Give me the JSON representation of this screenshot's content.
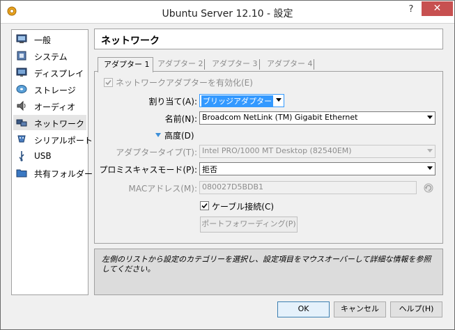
{
  "window": {
    "title": "Ubuntu Server 12.10 - 設定",
    "help_label": "?",
    "close_label": "✕",
    "accent_close": "#c75050"
  },
  "sidebar": {
    "items": [
      {
        "label": "一般",
        "icon": "monitor-icon"
      },
      {
        "label": "システム",
        "icon": "chip-icon"
      },
      {
        "label": "ディスプレイ",
        "icon": "display-icon"
      },
      {
        "label": "ストレージ",
        "icon": "disk-icon"
      },
      {
        "label": "オーディオ",
        "icon": "speaker-icon"
      },
      {
        "label": "ネットワーク",
        "icon": "network-icon",
        "selected": true
      },
      {
        "label": "シリアルポート",
        "icon": "serial-port-icon"
      },
      {
        "label": "USB",
        "icon": "usb-icon"
      },
      {
        "label": "共有フォルダー",
        "icon": "folder-icon"
      }
    ]
  },
  "page": {
    "title": "ネットワーク"
  },
  "tabs": [
    {
      "label": "アダプター 1",
      "active": true
    },
    {
      "label": "アダプター 2"
    },
    {
      "label": "アダプター 3"
    },
    {
      "label": "アダプター 4"
    }
  ],
  "adapter": {
    "enable_label": "ネットワークアダプターを有効化(E)",
    "enable_checked": true,
    "attached_label": "割り当て(A):",
    "attached_value": "ブリッジアダプター",
    "name_label": "名前(N):",
    "name_value": "Broadcom NetLink (TM) Gigabit Ethernet",
    "advanced_label": "高度(D)",
    "type_label": "アダプタータイプ(T):",
    "type_value": "Intel PRO/1000 MT Desktop (82540EM)",
    "promisc_label": "プロミスキャスモード(P):",
    "promisc_value": "拒否",
    "mac_label": "MACアドレス(M):",
    "mac_value": "080027D5BDB1",
    "cable_label": "ケーブル接続(C)",
    "cable_checked": true,
    "port_forward_label": "ポートフォワーディング(P)"
  },
  "info": {
    "text": "左側のリストから設定のカテゴリーを選択し、設定項目をマウスオーバーして詳細な情報を参照してください。"
  },
  "buttons": {
    "ok": "OK",
    "cancel": "キャンセル",
    "help": "ヘルプ(H)"
  }
}
